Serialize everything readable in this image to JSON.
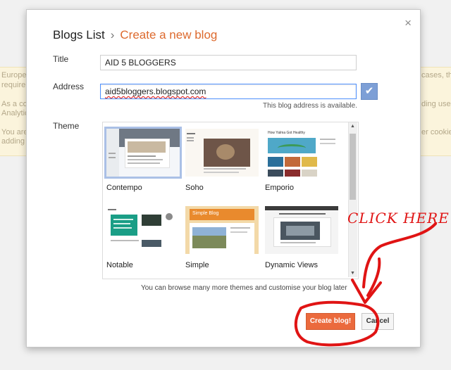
{
  "background": {
    "lines": [
      "European",
      "require y",
      "As a co",
      "Analytic",
      "You are",
      "adding t"
    ],
    "right_lines": [
      "cases, the",
      "ding use",
      "er cookie"
    ]
  },
  "dialog": {
    "breadcrumb_parent": "Blogs List",
    "breadcrumb_separator": "›",
    "breadcrumb_current": "Create a new blog",
    "close_symbol": "×",
    "title_label": "Title",
    "title_value": "AID 5 BLOGGERS",
    "address_label": "Address",
    "address_value": "aid5bloggers.blogspot.com",
    "check_symbol": "✔",
    "availability": "This blog address is available.",
    "theme_label": "Theme",
    "themes": [
      {
        "name": "Contempo",
        "selected": true
      },
      {
        "name": "Soho",
        "selected": false
      },
      {
        "name": "Emporio",
        "selected": false
      },
      {
        "name": "Notable",
        "selected": false
      },
      {
        "name": "Simple",
        "selected": false
      },
      {
        "name": "Dynamic Views",
        "selected": false
      }
    ],
    "theme_titles": {
      "emporio": "How Yalma Got Healthy",
      "simple": "Simple Blog"
    },
    "browse_text": "You can browse many more themes and customise your blog later",
    "create_button": "Create blog!",
    "cancel_button": "Cancel"
  },
  "annotation": {
    "text": "CLICK HERE",
    "color": "#e01414"
  },
  "colors": {
    "accent": "#dd6a2e",
    "create_button": "#eb6a3d",
    "focus_border": "#4d90fe"
  }
}
